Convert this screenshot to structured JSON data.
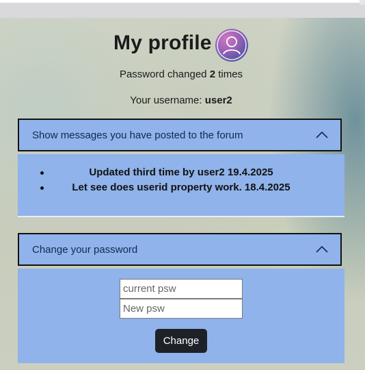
{
  "profile": {
    "title": "My profile",
    "password_changed_prefix": "Password changed ",
    "password_changed_count": "2",
    "password_changed_suffix": " times",
    "username_prefix": "Your username: ",
    "username": "user2"
  },
  "messages_section": {
    "header_label": "Show messages you have posted to the forum",
    "items": [
      "Updated third time by user2 19.4.2025",
      "Let see does userid property work. 18.4.2025"
    ]
  },
  "password_section": {
    "header_label": "Change your password",
    "current_placeholder": "current psw",
    "new_placeholder": "New psw",
    "submit_label": "Change"
  },
  "colors": {
    "accordion_bg": "#8fb3ea",
    "button_bg": "#1e2228"
  },
  "icons": {
    "avatar": "user-avatar-icon",
    "collapse": "chevron-up-icon"
  }
}
